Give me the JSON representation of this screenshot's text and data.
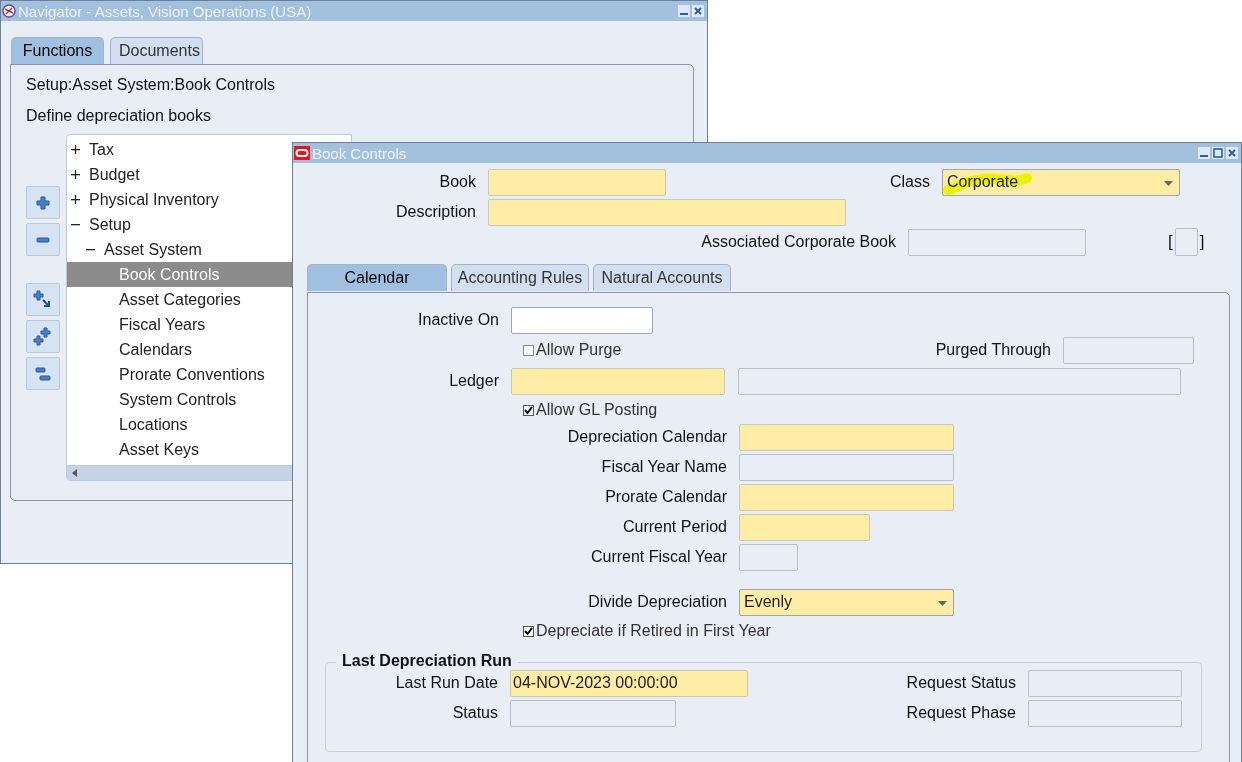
{
  "navigator": {
    "title": "Navigator - Assets, Vision Operations (USA)",
    "tabs": [
      {
        "label": "Functions",
        "selected": true
      },
      {
        "label": "Documents",
        "selected": false
      }
    ],
    "path": "Setup:Asset System:Book Controls",
    "description": "Define depreciation books",
    "tree": [
      {
        "label": "Tax",
        "expanded": false,
        "selected": false
      },
      {
        "label": "Budget",
        "expanded": false,
        "selected": false
      },
      {
        "label": "Physical Inventory",
        "expanded": false,
        "selected": false
      },
      {
        "label": "Setup",
        "expanded": true,
        "selected": false,
        "children": [
          {
            "label": "Asset System",
            "expanded": true,
            "selected": false,
            "children": [
              {
                "label": "Book Controls",
                "selected": true
              },
              {
                "label": "Asset Categories",
                "selected": false
              },
              {
                "label": "Fiscal Years",
                "selected": false
              },
              {
                "label": "Calendars",
                "selected": false
              },
              {
                "label": "Prorate Conventions",
                "selected": false
              },
              {
                "label": "System Controls",
                "selected": false
              },
              {
                "label": "Locations",
                "selected": false
              },
              {
                "label": "Asset Keys",
                "selected": false
              }
            ]
          }
        ]
      }
    ]
  },
  "book_controls": {
    "title": "Book Controls",
    "book": {
      "label": "Book",
      "kind": "required"
    },
    "class": {
      "label": "Class",
      "value": "Corporate",
      "kind": "required"
    },
    "description": {
      "label": "Description",
      "kind": "required"
    },
    "associated_corporate_book": {
      "label": "Associated Corporate Book",
      "kind": "readonly"
    },
    "flexfield": {
      "open": "[",
      "close": "]"
    },
    "tabs": [
      {
        "label": "Calendar",
        "selected": true
      },
      {
        "label": "Accounting Rules",
        "selected": false
      },
      {
        "label": "Natural Accounts",
        "selected": false
      }
    ],
    "inactive_on": {
      "label": "Inactive On",
      "kind": "optional"
    },
    "allow_purge": {
      "label": "Allow Purge",
      "checked": false
    },
    "purged_through": {
      "label": "Purged Through",
      "kind": "readonly"
    },
    "ledger": {
      "label": "Ledger",
      "fields": [
        {
          "kind": "required"
        },
        {
          "kind": "readonly"
        }
      ]
    },
    "allow_gl_posting": {
      "label": "Allow GL Posting",
      "checked": true
    },
    "calendar_fields": [
      {
        "label": "Depreciation Calendar",
        "kind": "required"
      },
      {
        "label": "Fiscal Year Name",
        "kind": "readonly"
      },
      {
        "label": "Prorate Calendar",
        "kind": "required"
      },
      {
        "label": "Current Period",
        "kind": "required"
      },
      {
        "label": "Current Fiscal Year",
        "kind": "readonly"
      }
    ],
    "divide_depreciation": {
      "label": "Divide Depreciation",
      "value": "Evenly",
      "kind": "required"
    },
    "depreciate_if_retired": {
      "label": "Depreciate if Retired in First Year",
      "checked": true
    },
    "last_run": {
      "title": "Last Depreciation Run",
      "last_run_date": {
        "label": "Last Run Date",
        "value": "04-NOV-2023 00:00:00",
        "kind": "required"
      },
      "request_status": {
        "label": "Request Status",
        "kind": "readonly"
      },
      "status": {
        "label": "Status",
        "kind": "readonly"
      },
      "request_phase": {
        "label": "Request Phase",
        "kind": "readonly"
      }
    }
  }
}
